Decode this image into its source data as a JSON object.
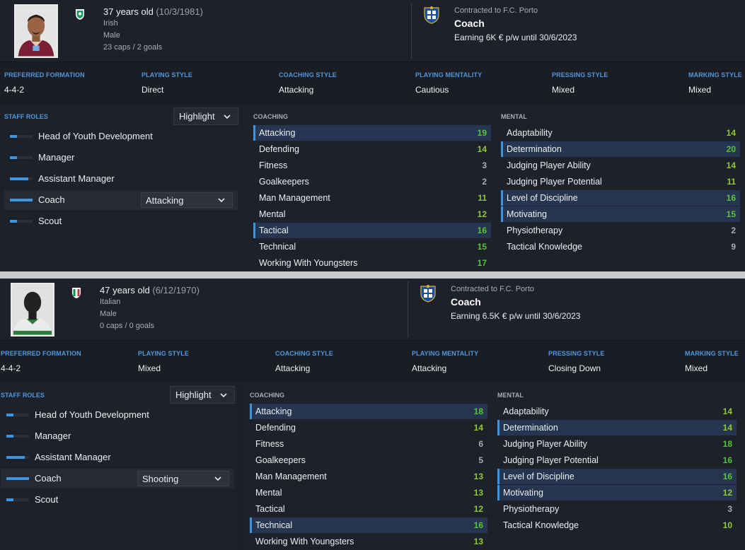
{
  "colors": {
    "accent": "#3f94e0",
    "good": "#8fc93a",
    "high": "#58c23d",
    "mid": "#8fc93a",
    "low": "#a7adb7",
    "label_blue": "#4f97de"
  },
  "profiles": [
    {
      "age": "37 years old",
      "dob": "(10/3/1981)",
      "nationality": "Irish",
      "gender": "Male",
      "caps": "23 caps / 2 goals",
      "contract": "Contracted to F.C. Porto",
      "job": "Coach",
      "earning": "Earning 6K € p/w until 30/6/2023",
      "tactics": [
        {
          "label": "PREFERRED FORMATION",
          "value": "4-4-2"
        },
        {
          "label": "PLAYING STYLE",
          "value": "Direct"
        },
        {
          "label": "COACHING STYLE",
          "value": "Attacking"
        },
        {
          "label": "PLAYING MENTALITY",
          "value": "Cautious"
        },
        {
          "label": "PRESSING STYLE",
          "value": "Mixed"
        },
        {
          "label": "MARKING STYLE",
          "value": "Mixed"
        }
      ],
      "roles_title": "STAFF ROLES",
      "highlight": "Highlight",
      "roles": [
        {
          "label": "Head of Youth Development",
          "level": 0.3
        },
        {
          "label": "Manager",
          "level": 0.3
        },
        {
          "label": "Assistant Manager",
          "level": 0.8
        },
        {
          "label": "Coach",
          "level": 1.0,
          "selected": true,
          "option": "Attacking"
        },
        {
          "label": "Scout",
          "level": 0.3
        }
      ],
      "coaching_title": "COACHING",
      "coaching": [
        {
          "name": "Attacking",
          "value": "19",
          "highlight": true
        },
        {
          "name": "Defending",
          "value": "14"
        },
        {
          "name": "Fitness",
          "value": "3"
        },
        {
          "name": "Goalkeepers",
          "value": "2"
        },
        {
          "name": "Man Management",
          "value": "11"
        },
        {
          "name": "Mental",
          "value": "12"
        },
        {
          "name": "Tactical",
          "value": "16",
          "highlight": true
        },
        {
          "name": "Technical",
          "value": "15"
        },
        {
          "name": "Working With Youngsters",
          "value": "17"
        }
      ],
      "mental_title": "MENTAL",
      "mental": [
        {
          "name": "Adaptability",
          "value": "14"
        },
        {
          "name": "Determination",
          "value": "20",
          "highlight": true
        },
        {
          "name": "Judging Player Ability",
          "value": "14"
        },
        {
          "name": "Judging Player Potential",
          "value": "11"
        },
        {
          "name": "Level of Discipline",
          "value": "16",
          "highlight": true
        },
        {
          "name": "Motivating",
          "value": "15",
          "highlight": true
        },
        {
          "name": "Physiotherapy",
          "value": "2"
        },
        {
          "name": "Tactical Knowledge",
          "value": "9"
        }
      ]
    },
    {
      "age": "47 years old",
      "dob": "(6/12/1970)",
      "nationality": "Italian",
      "gender": "Male",
      "caps": "0 caps / 0 goals",
      "contract": "Contracted to F.C. Porto",
      "job": "Coach",
      "earning": "Earning 6.5K € p/w until 30/6/2023",
      "tactics": [
        {
          "label": "PREFERRED FORMATION",
          "value": "4-4-2"
        },
        {
          "label": "PLAYING STYLE",
          "value": "Mixed"
        },
        {
          "label": "COACHING STYLE",
          "value": "Attacking"
        },
        {
          "label": "PLAYING MENTALITY",
          "value": "Attacking"
        },
        {
          "label": "PRESSING STYLE",
          "value": "Closing Down"
        },
        {
          "label": "MARKING STYLE",
          "value": "Mixed"
        }
      ],
      "roles_title": "STAFF ROLES",
      "highlight": "Highlight",
      "roles": [
        {
          "label": "Head of Youth Development",
          "level": 0.3
        },
        {
          "label": "Manager",
          "level": 0.3
        },
        {
          "label": "Assistant Manager",
          "level": 0.8
        },
        {
          "label": "Coach",
          "level": 1.0,
          "selected": true,
          "option": "Shooting"
        },
        {
          "label": "Scout",
          "level": 0.3
        }
      ],
      "coaching_title": "COACHING",
      "coaching": [
        {
          "name": "Attacking",
          "value": "18",
          "highlight": true
        },
        {
          "name": "Defending",
          "value": "14"
        },
        {
          "name": "Fitness",
          "value": "6"
        },
        {
          "name": "Goalkeepers",
          "value": "5"
        },
        {
          "name": "Man Management",
          "value": "13"
        },
        {
          "name": "Mental",
          "value": "13"
        },
        {
          "name": "Tactical",
          "value": "12"
        },
        {
          "name": "Technical",
          "value": "16",
          "highlight": true
        },
        {
          "name": "Working With Youngsters",
          "value": "13"
        }
      ],
      "mental_title": "MENTAL",
      "mental": [
        {
          "name": "Adaptability",
          "value": "14"
        },
        {
          "name": "Determination",
          "value": "14",
          "highlight": true
        },
        {
          "name": "Judging Player Ability",
          "value": "18"
        },
        {
          "name": "Judging Player Potential",
          "value": "16"
        },
        {
          "name": "Level of Discipline",
          "value": "16",
          "highlight": true
        },
        {
          "name": "Motivating",
          "value": "12",
          "highlight": true
        },
        {
          "name": "Physiotherapy",
          "value": "3"
        },
        {
          "name": "Tactical Knowledge",
          "value": "10"
        }
      ]
    }
  ]
}
